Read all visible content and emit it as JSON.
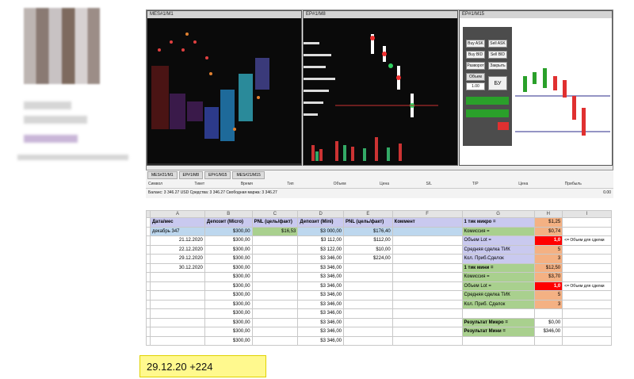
{
  "colors": {
    "green": "#a9d08e",
    "purple": "#c9c9ef",
    "red": "#ff0000",
    "orange": "#f4b183",
    "yellow": "#fff98e",
    "blue": "#bdd7ee"
  },
  "platform": {
    "chart1_title": "MES#1/M1",
    "chart2_title": "EP#1/M8",
    "chart3_title": "EP#1/M15",
    "trade": {
      "buy_ask": "Buy ASK",
      "sell_ask": "Sell ASK",
      "buy_bid": "Buy BID",
      "sell_bid": "Sell BID",
      "reverse": "Разворот",
      "close": "Закрыть",
      "be": "БУ",
      "volume_label": "Объем",
      "volume": "1.00"
    },
    "tabs": [
      "MES#21/M1",
      "EP#1/M8",
      "EP#1/M15",
      "MES#21/M15"
    ],
    "columns": [
      "Символ",
      "Тикет",
      "Время",
      "Тип",
      "Объем",
      "Цена",
      "S/L",
      "T/P",
      "Цена",
      "Прибыль"
    ],
    "balance": "Баланс: 3 346.27 USD  Средства: 3 346.27  Свободная маржа: 3 346.27",
    "profit_total": "0.00"
  },
  "sheet": {
    "col_letters": [
      "",
      "A",
      "B",
      "C",
      "D",
      "E",
      "F",
      "G",
      "H",
      "I"
    ],
    "headers": [
      "Дата/мес",
      "Депозит (Micro)",
      "PNL (цель/факт)",
      "Депозит (Mini)",
      "PNL (цель/факт)",
      "Коммент"
    ],
    "rows": [
      {
        "a": "декабрь 347",
        "b": "$300,00",
        "c": "$16,53",
        "d": "$3 000,00",
        "e": "$176,40",
        "g": "1 тик микро =",
        "h": "$1,25",
        "i": ""
      },
      {
        "a": "21.12.2020",
        "b": "$300,00",
        "c": "",
        "d": "$3 112,00",
        "e": "$112,00",
        "g": "Комиссия =",
        "h": "$0,74",
        "i": ""
      },
      {
        "a": "22.12.2020",
        "b": "$300,00",
        "c": "",
        "d": "$3 122,00",
        "e": "$10,00",
        "g": "Объем Lot =",
        "h": "1,0",
        "i": "<= Объем для сделки"
      },
      {
        "a": "29.12.2020",
        "b": "$300,00",
        "c": "",
        "d": "$3 346,00",
        "e": "$224,00",
        "g": "Средняя сделка ТИК",
        "h": "5",
        "i": ""
      },
      {
        "a": "30.12.2020",
        "b": "$300,00",
        "c": "",
        "d": "$3 346,00",
        "e": "",
        "g": "Кол. Приб.Сделок",
        "h": "3",
        "i": ""
      },
      {
        "a": "",
        "b": "$300,00",
        "c": "",
        "d": "$3 346,00",
        "e": "",
        "g": "1 тик мини =",
        "h": "$12,50",
        "i": ""
      },
      {
        "a": "",
        "b": "$300,00",
        "c": "",
        "d": "$3 346,00",
        "e": "",
        "g": "Комиссия =",
        "h": "$3,70",
        "i": ""
      },
      {
        "a": "",
        "b": "$300,00",
        "c": "",
        "d": "$3 346,00",
        "e": "",
        "g": "Объем Lot =",
        "h": "1,0",
        "i": "<= Объем для сделки"
      },
      {
        "a": "",
        "b": "$300,00",
        "c": "",
        "d": "$3 346,00",
        "e": "",
        "g": "Средняя сделка ТИК",
        "h": "5",
        "i": ""
      },
      {
        "a": "",
        "b": "$300,00",
        "c": "",
        "d": "$3 346,00",
        "e": "",
        "g": "Кол. Приб. Сделок",
        "h": "3",
        "i": ""
      },
      {
        "a": "",
        "b": "$300,00",
        "c": "",
        "d": "$3 346,00",
        "e": "",
        "g": "",
        "h": "",
        "i": ""
      },
      {
        "a": "",
        "b": "$300,00",
        "c": "",
        "d": "$3 346,00",
        "e": "",
        "g": "Результат Микро =",
        "h": "$0,00",
        "i": ""
      },
      {
        "a": "",
        "b": "$300,00",
        "c": "",
        "d": "$3 346,00",
        "e": "",
        "g": "Результат Мини =",
        "h": "$346,00",
        "i": ""
      }
    ]
  },
  "note": "29.12.20 +224"
}
